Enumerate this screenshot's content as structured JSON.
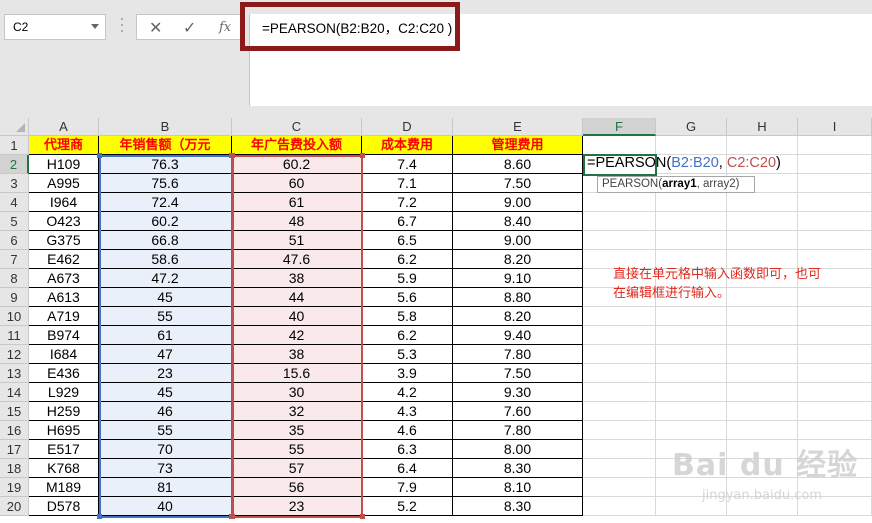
{
  "name_box": {
    "value": "C2"
  },
  "formula_bar": {
    "cancel_symbol": "✕",
    "enter_symbol": "✓",
    "fx_symbol": "fx",
    "formula": "=PEARSON(B2:B20，C2:C20 )"
  },
  "columns": [
    "A",
    "B",
    "C",
    "D",
    "E",
    "F",
    "G",
    "H",
    "I"
  ],
  "rows": [
    "1",
    "2",
    "3",
    "4",
    "5",
    "6",
    "7",
    "8",
    "9",
    "10",
    "11",
    "12",
    "13",
    "14",
    "15",
    "16",
    "17",
    "18",
    "19",
    "20"
  ],
  "table": {
    "headers": [
      "代理商",
      "年销售额（万元",
      "年广告费投入额",
      "成本费用",
      "管理费用"
    ],
    "data": [
      [
        "H109",
        "76.3",
        "60.2",
        "7.4",
        "8.60"
      ],
      [
        "A995",
        "75.6",
        "60",
        "7.1",
        "7.50"
      ],
      [
        "I964",
        "72.4",
        "61",
        "7.2",
        "9.00"
      ],
      [
        "O423",
        "60.2",
        "48",
        "6.7",
        "8.40"
      ],
      [
        "G375",
        "66.8",
        "51",
        "6.5",
        "9.00"
      ],
      [
        "E462",
        "58.6",
        "47.6",
        "6.2",
        "8.20"
      ],
      [
        "A673",
        "47.2",
        "38",
        "5.9",
        "9.10"
      ],
      [
        "A613",
        "45",
        "44",
        "5.6",
        "8.80"
      ],
      [
        "A719",
        "55",
        "40",
        "5.8",
        "8.20"
      ],
      [
        "B974",
        "61",
        "42",
        "6.2",
        "9.40"
      ],
      [
        "I684",
        "47",
        "38",
        "5.3",
        "7.80"
      ],
      [
        "E436",
        "23",
        "15.6",
        "3.9",
        "7.50"
      ],
      [
        "L929",
        "45",
        "30",
        "4.2",
        "9.30"
      ],
      [
        "H259",
        "46",
        "32",
        "4.3",
        "7.60"
      ],
      [
        "H695",
        "55",
        "35",
        "4.6",
        "7.80"
      ],
      [
        "E517",
        "70",
        "55",
        "6.3",
        "8.00"
      ],
      [
        "K768",
        "73",
        "57",
        "6.4",
        "8.30"
      ],
      [
        "M189",
        "81",
        "56",
        "7.9",
        "8.10"
      ],
      [
        "D578",
        "40",
        "23",
        "5.2",
        "8.30"
      ]
    ]
  },
  "active_cell": {
    "func": "=PEARSON(",
    "arg1": "B2:B20",
    "sep": ",   ",
    "arg2": "C2:C20",
    "close": ")"
  },
  "tooltip": {
    "func": "PEARSON(",
    "arg1": "array1",
    "rest": ", array2)"
  },
  "note": {
    "line1": "直接在单元格中输入函数即可，也可",
    "line2": "在编辑框进行输入。"
  },
  "watermark": {
    "logo": "Bai du 经验",
    "url": "jingyan.baidu.com"
  },
  "colors": {
    "header_bg": "#ffff00",
    "header_text": "#ff0000",
    "range_blue": "#4472c4",
    "range_red": "#c0504d",
    "active": "#217346",
    "note": "#e0291f"
  }
}
